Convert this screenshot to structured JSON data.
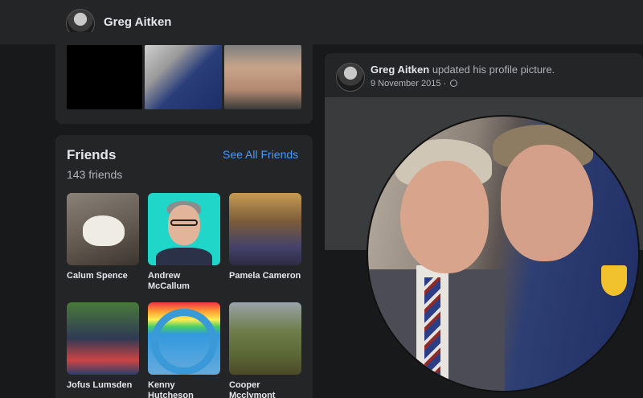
{
  "header": {
    "name": "Greg Aitken",
    "avatar_icon": "profile-avatar"
  },
  "friends": {
    "title": "Friends",
    "see_all_label": "See All Friends",
    "count_text": "143 friends",
    "list": [
      {
        "name": "Calum Spence"
      },
      {
        "name": "Andrew McCallum"
      },
      {
        "name": "Pamela Cameron"
      },
      {
        "name": "Jofus Lumsden"
      },
      {
        "name": "Kenny Hutcheson"
      },
      {
        "name": "Cooper Mcclymont"
      }
    ]
  },
  "post": {
    "author": "Greg Aitken",
    "action": " updated his profile picture.",
    "date": "9 November 2015 · ",
    "privacy_icon": "globe-icon"
  },
  "colors": {
    "background": "#18191a",
    "card": "#242526",
    "link": "#4599ff"
  }
}
